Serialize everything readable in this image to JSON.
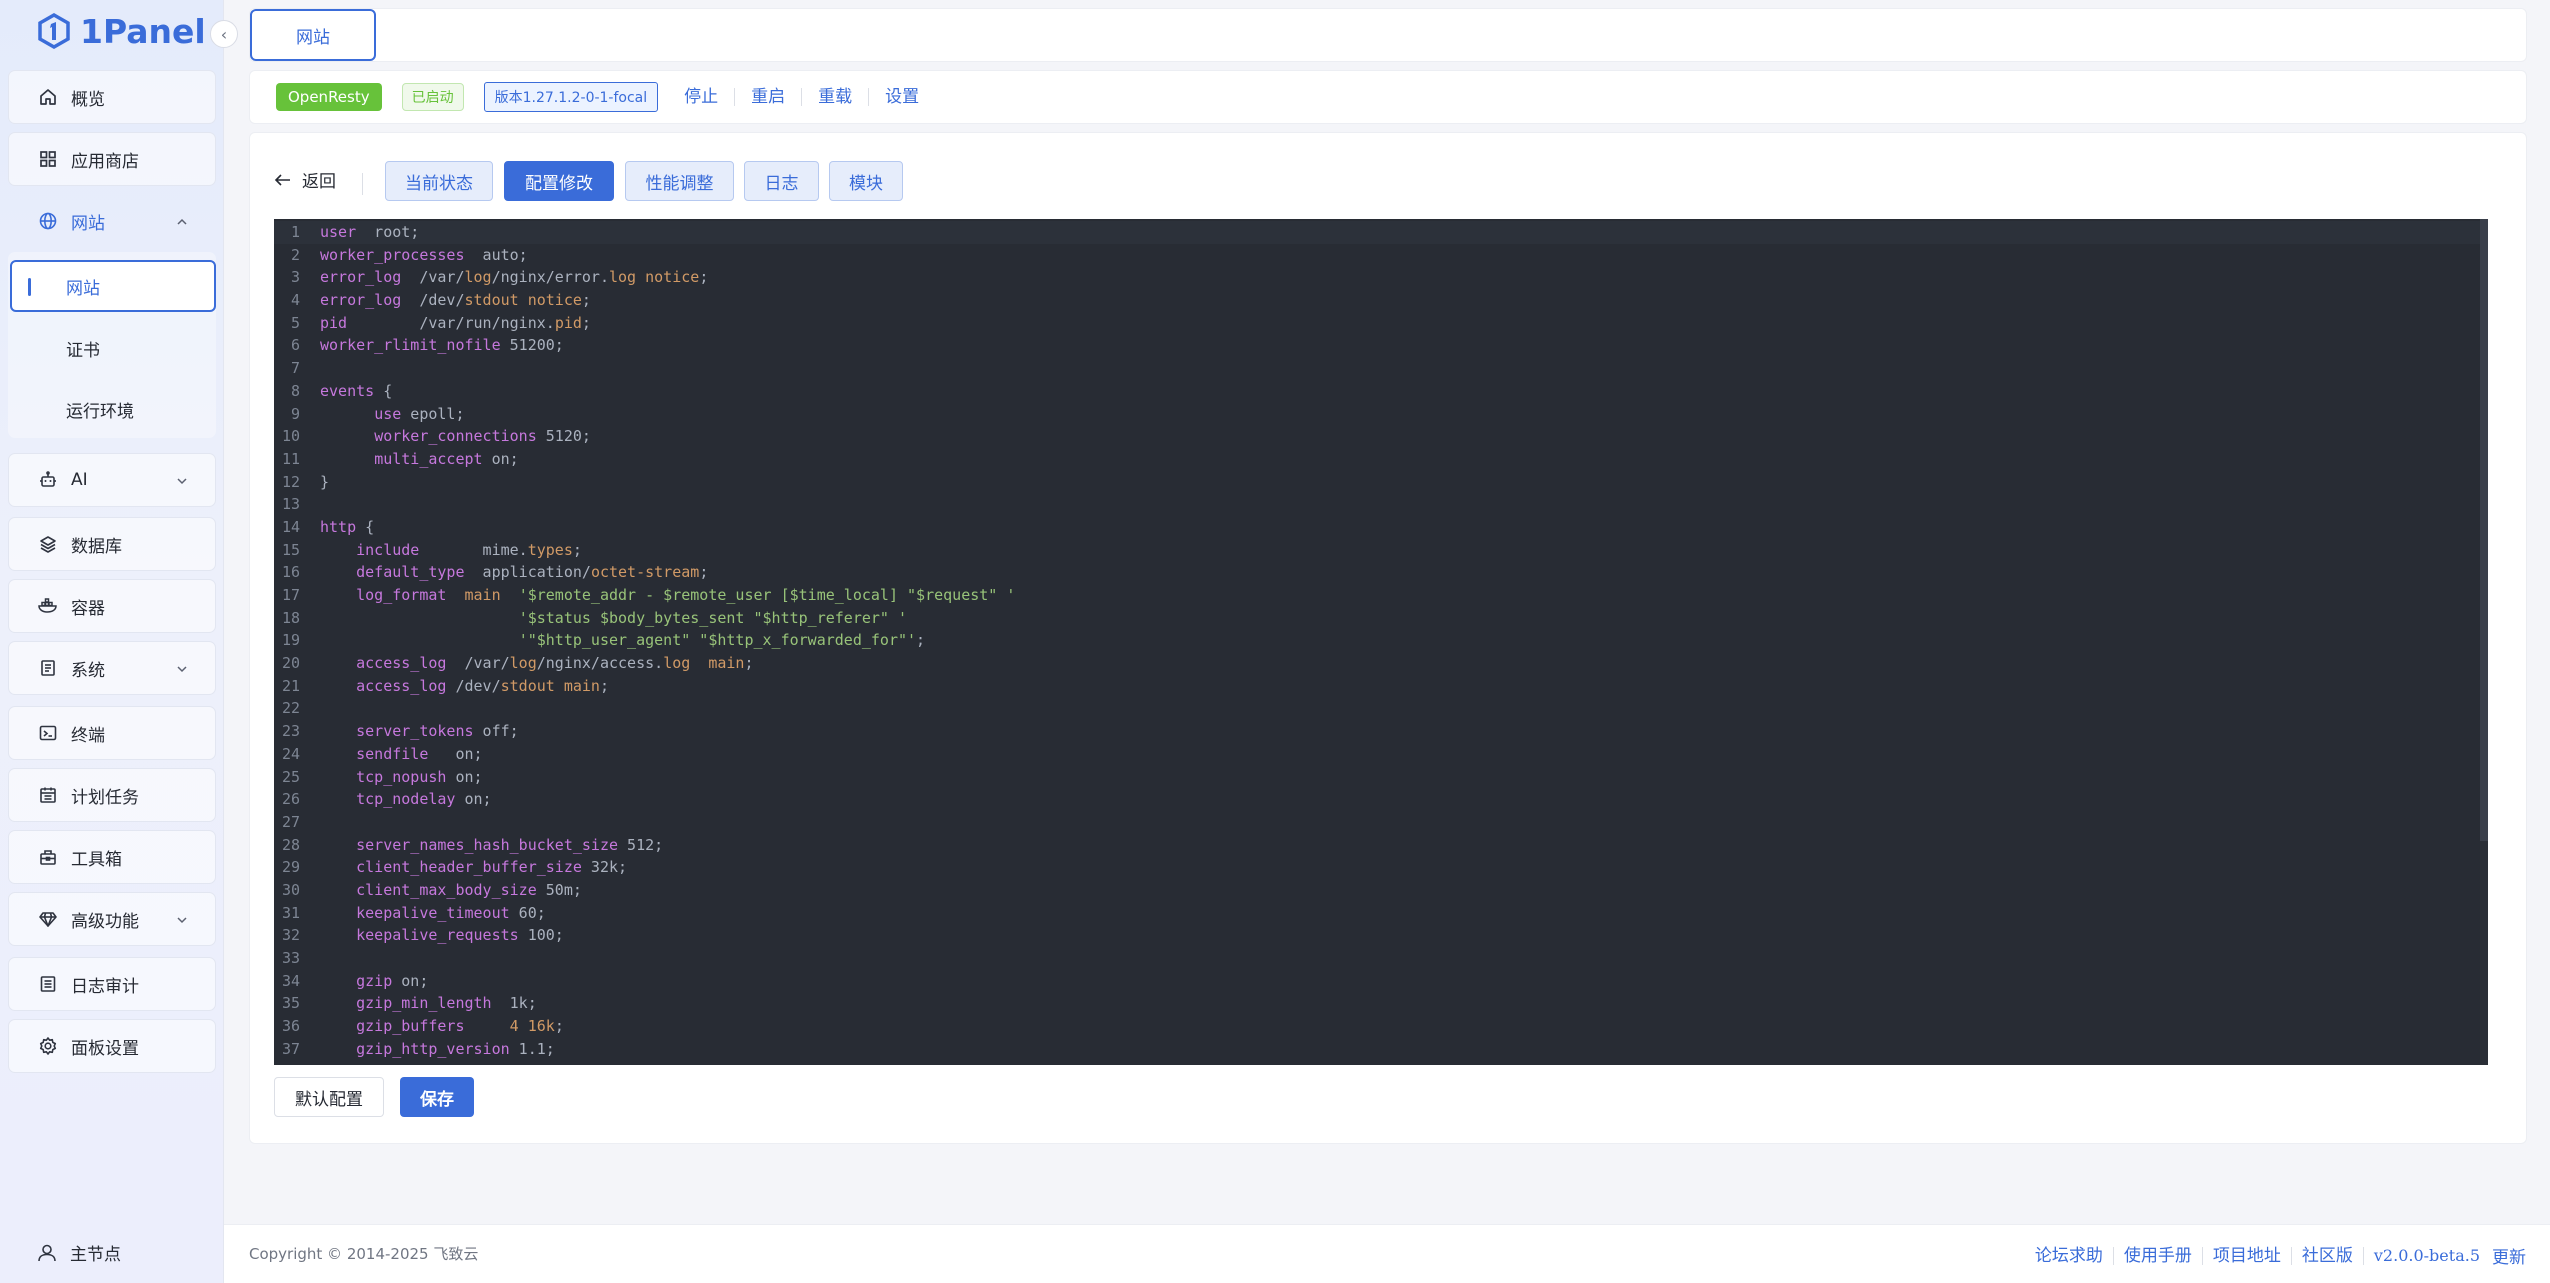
{
  "brand": {
    "name": "1Panel"
  },
  "sidebar": {
    "items": [
      {
        "label": "概览",
        "icon": "home-icon"
      },
      {
        "label": "应用商店",
        "icon": "grid-icon"
      },
      {
        "label": "网站",
        "icon": "globe-icon",
        "expanded": true
      },
      {
        "label": "AI",
        "icon": "robot-icon"
      },
      {
        "label": "数据库",
        "icon": "layers-icon"
      },
      {
        "label": "容器",
        "icon": "container-icon"
      },
      {
        "label": "系统",
        "icon": "system-icon"
      },
      {
        "label": "终端",
        "icon": "terminal-icon"
      },
      {
        "label": "计划任务",
        "icon": "calendar-icon"
      },
      {
        "label": "工具箱",
        "icon": "toolbox-icon"
      },
      {
        "label": "高级功能",
        "icon": "diamond-icon"
      },
      {
        "label": "日志审计",
        "icon": "log-icon"
      },
      {
        "label": "面板设置",
        "icon": "gear-icon"
      }
    ],
    "website_sub": [
      "网站",
      "证书",
      "运行环境"
    ],
    "node_label": "主节点"
  },
  "topbar": {
    "tab_label": "网站"
  },
  "status": {
    "app_name": "OpenResty",
    "state": "已启动",
    "version": "版本1.27.1.2-0-1-focal",
    "actions": [
      "停止",
      "重启",
      "重载",
      "设置"
    ]
  },
  "toolbar": {
    "back_label": "返回",
    "tabs": [
      "当前状态",
      "配置修改",
      "性能调整",
      "日志",
      "模块"
    ],
    "selected_tab": "配置修改"
  },
  "editor": {
    "lines": [
      "user  root;",
      "worker_processes  auto;",
      "error_log  /var/log/nginx/error.log notice;",
      "error_log  /dev/stdout notice;",
      "pid        /var/run/nginx.pid;",
      "worker_rlimit_nofile 51200;",
      "",
      "events {",
      "      use epoll;",
      "      worker_connections 5120;",
      "      multi_accept on;",
      "}",
      "",
      "http {",
      "    include       mime.types;",
      "    default_type  application/octet-stream;",
      "    log_format  main  '$remote_addr - $remote_user [$time_local] \"$request\" '",
      "                      '$status $body_bytes_sent \"$http_referer\" '",
      "                      '\"$http_user_agent\" \"$http_x_forwarded_for\"';",
      "    access_log  /var/log/nginx/access.log  main;",
      "    access_log /dev/stdout main;",
      "",
      "    server_tokens off;",
      "    sendfile   on;",
      "    tcp_nopush on;",
      "    tcp_nodelay on;",
      "",
      "    server_names_hash_bucket_size 512;",
      "    client_header_buffer_size 32k;",
      "    client_max_body_size 50m;",
      "    keepalive_timeout 60;",
      "    keepalive_requests 100;",
      "",
      "    gzip on;",
      "    gzip_min_length  1k;",
      "    gzip_buffers     4 16k;",
      "    gzip_http_version 1.1;"
    ]
  },
  "buttons": {
    "default_config": "默认配置",
    "save": "保存"
  },
  "footer": {
    "copyright": "Copyright © 2014-2025 飞致云",
    "links": [
      "论坛求助",
      "使用手册",
      "项目地址",
      "社区版"
    ],
    "version": "v2.0.0-beta.5",
    "update": "更新"
  },
  "colors": {
    "accent": "#3a6cd9",
    "success": "#67c23a",
    "editor_bg": "#282c34"
  }
}
